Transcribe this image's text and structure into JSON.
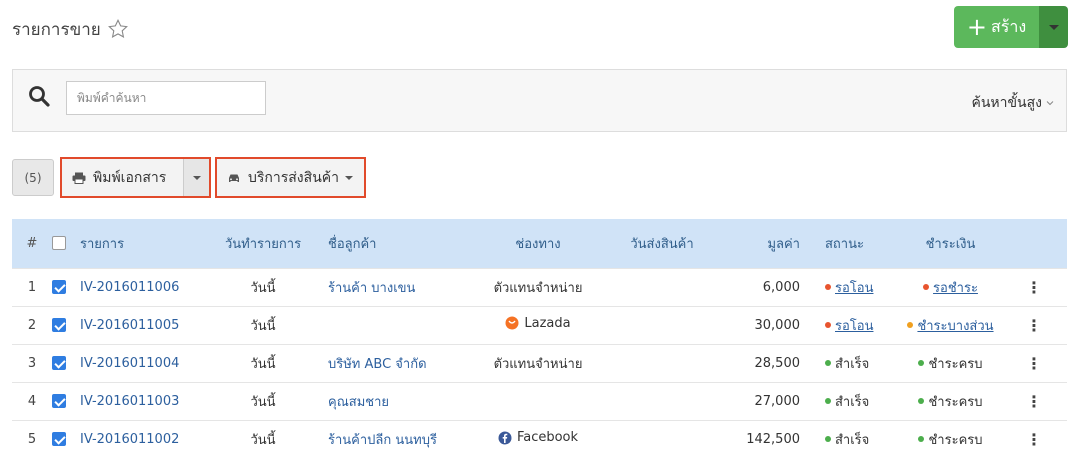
{
  "header": {
    "title": "รายการขาย",
    "create_label": "สร้าง"
  },
  "search": {
    "placeholder": "พิมพ์คำค้นหา",
    "advanced_label": "ค้นหาขั้นสูง"
  },
  "toolbar": {
    "count_label": "(5)",
    "print_label": "พิมพ์เอกสาร",
    "shipping_label": "บริการส่งสินค้า"
  },
  "table": {
    "columns": {
      "num": "#",
      "item": "รายการ",
      "date": "วันทำรายการ",
      "customer": "ชื่อลูกค้า",
      "channel": "ช่องทาง",
      "ship_date": "วันส่งสินค้า",
      "value": "มูลค่า",
      "status": "สถานะ",
      "payment": "ชำระเงิน"
    },
    "rows": [
      {
        "num": "1",
        "id": "IV-2016011006",
        "date": "วันนี้",
        "customer": "ร้านค้า บางเขน",
        "channel": "ตัวแทนจำหน่าย",
        "channel_icon": "",
        "value": "6,000",
        "status": "รอโอน",
        "status_color": "red",
        "payment": "รอชำระ",
        "payment_color": "red"
      },
      {
        "num": "2",
        "id": "IV-2016011005",
        "date": "วันนี้",
        "customer": "",
        "channel": "Lazada",
        "channel_icon": "lazada-icon",
        "value": "30,000",
        "status": "รอโอน",
        "status_color": "red",
        "payment": "ชำระบางส่วน",
        "payment_color": "orange"
      },
      {
        "num": "3",
        "id": "IV-2016011004",
        "date": "วันนี้",
        "customer": "บริษัท ABC จำกัด",
        "channel": "ตัวแทนจำหน่าย",
        "channel_icon": "",
        "value": "28,500",
        "status": "สำเร็จ",
        "status_color": "green",
        "payment": "ชำระครบ",
        "payment_color": "green"
      },
      {
        "num": "4",
        "id": "IV-2016011003",
        "date": "วันนี้",
        "customer": "คุณสมชาย",
        "channel": "",
        "channel_icon": "",
        "value": "27,000",
        "status": "สำเร็จ",
        "status_color": "green",
        "payment": "ชำระครบ",
        "payment_color": "green"
      },
      {
        "num": "5",
        "id": "IV-2016011002",
        "date": "วันนี้",
        "customer": "ร้านค้าปลีก นนทบุรี",
        "channel": "Facebook",
        "channel_icon": "facebook-icon",
        "value": "142,500",
        "status": "สำเร็จ",
        "status_color": "green",
        "payment": "ชำระครบ",
        "payment_color": "green"
      }
    ]
  },
  "colors": {
    "create_button": "#5cb85c",
    "header_row": "#d0e3f7",
    "highlight_border": "#e14a2b",
    "link": "#2c5f9e"
  }
}
